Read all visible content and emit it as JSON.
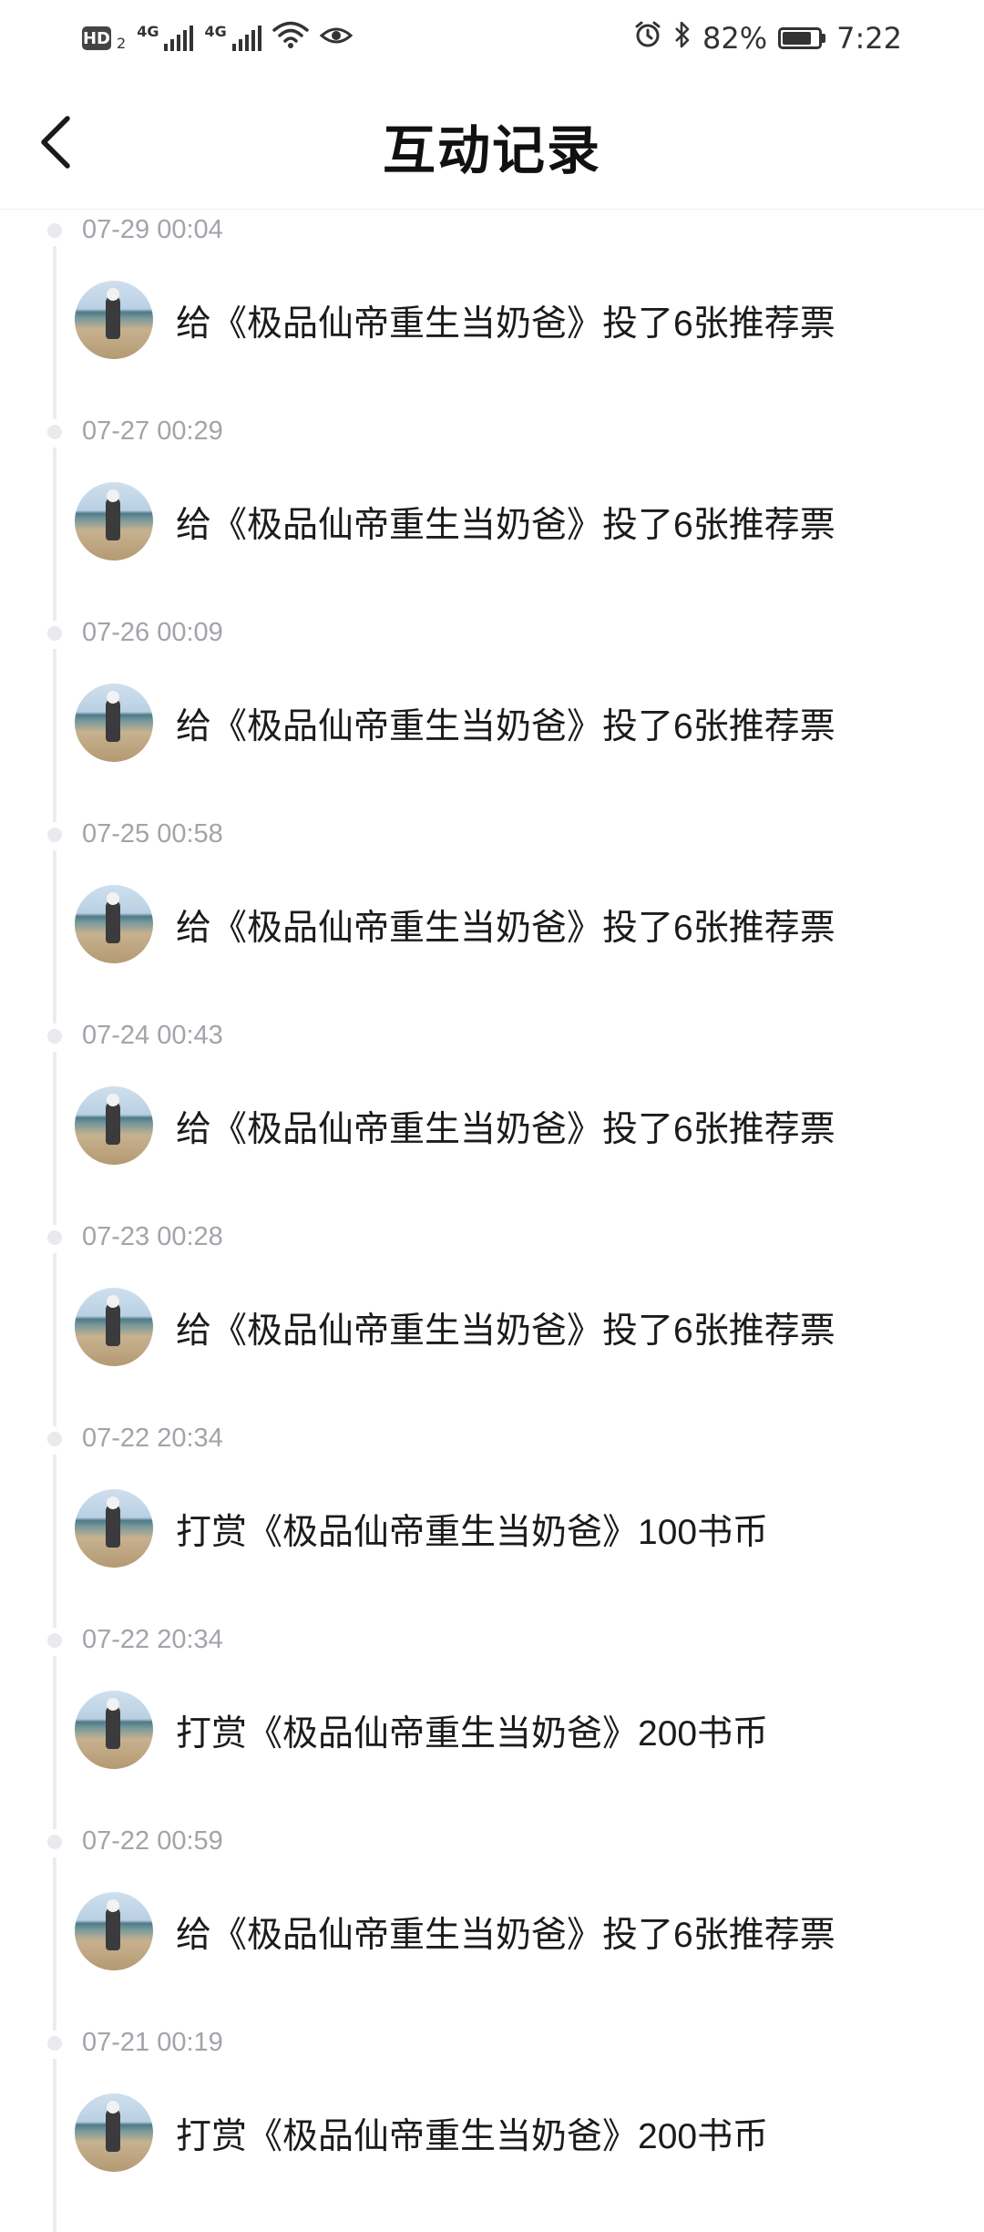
{
  "status_bar": {
    "hd": "HD",
    "sim": "2",
    "net1": "4G",
    "net2": "4G",
    "battery": "82%",
    "battery_level": 0.82,
    "time": "7:22",
    "icons": [
      "hd-icon",
      "signal-icon",
      "signal-icon",
      "wifi-icon",
      "eye-icon",
      "alarm-icon",
      "bluetooth-icon",
      "battery-icon"
    ]
  },
  "header": {
    "title": "互动记录",
    "back_icon": "chevron-left-icon"
  },
  "records": [
    {
      "time": "07-29 00:04",
      "text": "给《极品仙帝重生当奶爸》投了6张推荐票"
    },
    {
      "time": "07-27 00:29",
      "text": "给《极品仙帝重生当奶爸》投了6张推荐票"
    },
    {
      "time": "07-26 00:09",
      "text": "给《极品仙帝重生当奶爸》投了6张推荐票"
    },
    {
      "time": "07-25 00:58",
      "text": "给《极品仙帝重生当奶爸》投了6张推荐票"
    },
    {
      "time": "07-24 00:43",
      "text": "给《极品仙帝重生当奶爸》投了6张推荐票"
    },
    {
      "time": "07-23 00:28",
      "text": "给《极品仙帝重生当奶爸》投了6张推荐票"
    },
    {
      "time": "07-22 20:34",
      "text": "打赏《极品仙帝重生当奶爸》100书币"
    },
    {
      "time": "07-22 20:34",
      "text": "打赏《极品仙帝重生当奶爸》200书币"
    },
    {
      "time": "07-22 00:59",
      "text": "给《极品仙帝重生当奶爸》投了6张推荐票"
    },
    {
      "time": "07-21 00:19",
      "text": "打赏《极品仙帝重生当奶爸》200书币"
    }
  ],
  "colors": {
    "time_text": "#a3a3aa",
    "timeline": "#ececf0",
    "title": "#111111"
  }
}
